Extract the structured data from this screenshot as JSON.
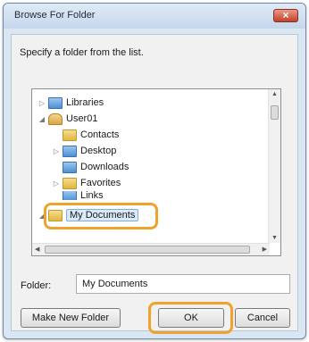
{
  "window": {
    "title": "Browse For Folder",
    "close_glyph": "×"
  },
  "prompt": "Specify a folder from the list.",
  "tree": {
    "items": [
      {
        "label": "Libraries",
        "expander": "▷",
        "icon": "libraries-folder-icon"
      },
      {
        "label": "User01",
        "expander": "◢",
        "icon": "user-folder-icon"
      },
      {
        "label": "Contacts",
        "expander": "",
        "icon": "contacts-folder-icon"
      },
      {
        "label": "Desktop",
        "expander": "▷",
        "icon": "desktop-folder-icon"
      },
      {
        "label": "Downloads",
        "expander": "",
        "icon": "downloads-folder-icon"
      },
      {
        "label": "Favorites",
        "expander": "▷",
        "icon": "favorites-folder-icon"
      },
      {
        "label": "Links",
        "expander": "",
        "icon": "links-folder-icon"
      },
      {
        "label": "My Documents",
        "expander": "◢",
        "icon": "documents-folder-icon",
        "selected": true
      }
    ]
  },
  "folder_field": {
    "label": "Folder:",
    "value": "My Documents"
  },
  "buttons": {
    "make_new": "Make New Folder",
    "ok": "OK",
    "cancel": "Cancel"
  },
  "colors": {
    "highlight": "#f0a22c",
    "selection": "#dbeaf8"
  }
}
